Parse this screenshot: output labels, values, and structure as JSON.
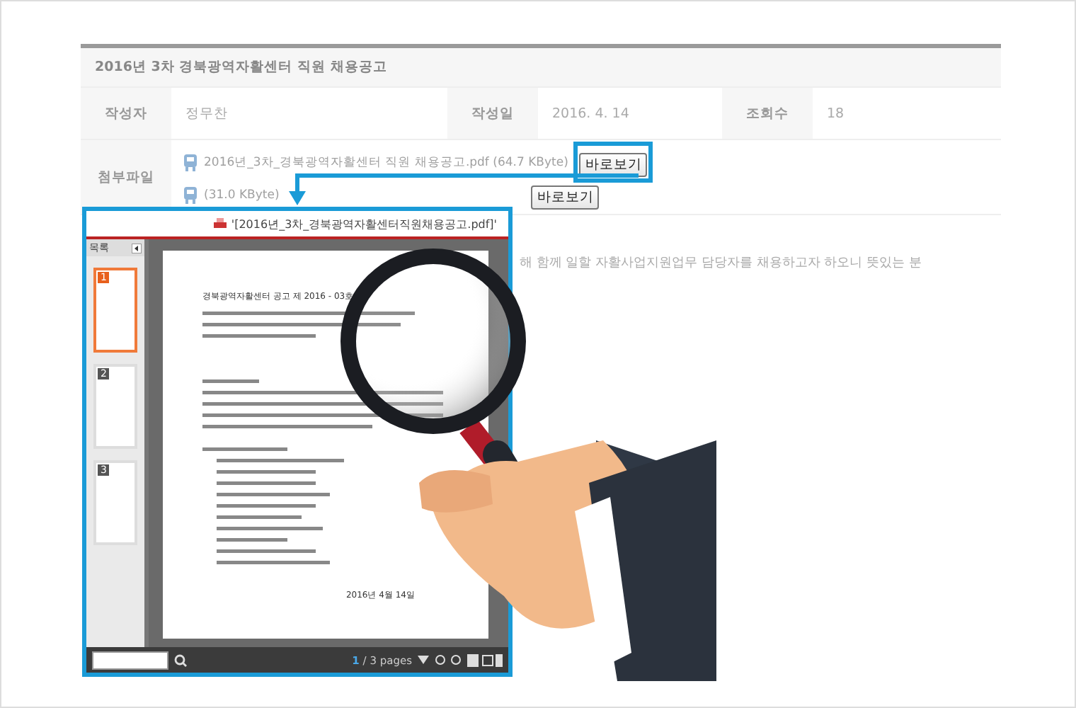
{
  "post": {
    "title": "2016년 3차 경북광역자활센터 직원 채용공고",
    "meta": [
      {
        "label": "작성자",
        "value": "정무찬"
      },
      {
        "label": "작성일",
        "value": "2016. 4. 14"
      },
      {
        "label": "조회수",
        "value": "18"
      }
    ],
    "attachments_label": "첨부파일",
    "attachments": [
      {
        "name": "2016년_3차_경북광역자활센터 직원 채용공고.pdf (64.7 KByte)",
        "button": "바로보기",
        "highlighted": true
      },
      {
        "name": "(31.0 KByte)",
        "button": "바로보기",
        "highlighted": false
      }
    ],
    "body_text": "해 함께 일할 자활사업지원업무 담당자를 채용하고자 하오니 뜻있는 분"
  },
  "viewer": {
    "title": "'[2016년_3차_경북광역자활센터직원채용공고.pdf]'",
    "sidebar_title": "목록",
    "thumbnails": [
      {
        "number": "1",
        "selected": true
      },
      {
        "number": "2",
        "selected": false
      },
      {
        "number": "3",
        "selected": false
      }
    ],
    "document": {
      "header": "경북광역자활센터 공고 제 2016 - 03호",
      "date": "2016년 4월 14일"
    },
    "pager": {
      "current": "1",
      "total": "/ 3 pages"
    }
  }
}
